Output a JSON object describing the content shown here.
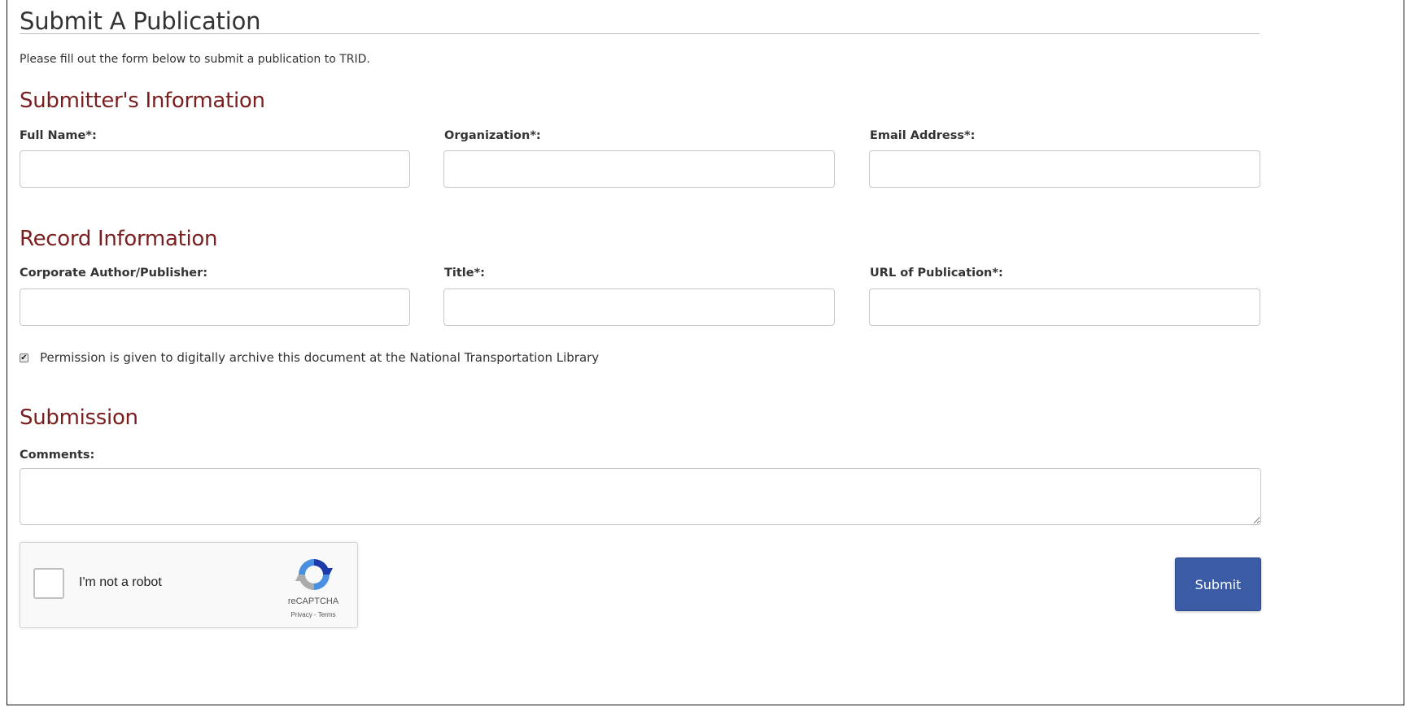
{
  "page": {
    "title": "Submit A Publication",
    "intro": "Please fill out the form below to submit a publication to TRID."
  },
  "submitter": {
    "heading": "Submitter's Information",
    "full_name": {
      "label": "Full Name*:",
      "value": ""
    },
    "organization": {
      "label": "Organization*:",
      "value": ""
    },
    "email": {
      "label": "Email Address*:",
      "value": ""
    }
  },
  "record": {
    "heading": "Record Information",
    "corporate_author": {
      "label": "Corporate Author/Publisher:",
      "value": ""
    },
    "title": {
      "label": "Title*:",
      "value": ""
    },
    "url": {
      "label": "URL of Publication*:",
      "value": ""
    },
    "permission": {
      "checked": true,
      "label": "Permission is given to digitally archive this document at the National Transportation Library"
    }
  },
  "submission": {
    "heading": "Submission",
    "comments": {
      "label": "Comments:",
      "value": ""
    }
  },
  "captcha": {
    "label": "I'm not a robot",
    "brand": "reCAPTCHA",
    "links": "Privacy - Terms",
    "logo_icon": "recaptcha-logo-icon"
  },
  "actions": {
    "submit_label": "Submit"
  },
  "colors": {
    "section_heading": "#7a1f1f",
    "submit_button": "#3b5ba5"
  }
}
